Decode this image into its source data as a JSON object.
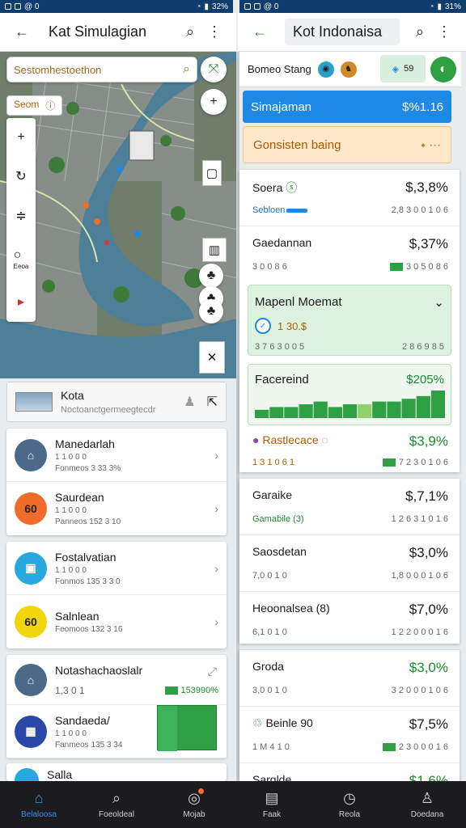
{
  "left": {
    "status": {
      "time": "@ 0",
      "battery": "32%"
    },
    "header": {
      "title": "Kat Simulagian"
    },
    "search": {
      "placeholder": "Sestomhestoethon"
    },
    "chip": {
      "label": "Seom"
    },
    "rail": {
      "small_label": "Eeoa"
    },
    "kota": {
      "title": "Kota",
      "subtitle": "Noctoanctgermeegtecdr"
    },
    "list": [
      {
        "title": "Manedarlah",
        "line1": "1 1 0 0 0",
        "line2": "Fonmeos 3 33 3%",
        "avatar_text": "",
        "avatar_color": "#4b6a89"
      },
      {
        "title": "Saurdean",
        "line1": "1 1 0 0 0",
        "line2": "Panneos 152 3 10",
        "avatar_text": "60",
        "avatar_color": "#ef6c2a"
      },
      {
        "title": "Fostalvatian",
        "line1": "1 1 0 0 0",
        "line2": "Fonmos 135 3 3 0",
        "avatar_text": "",
        "avatar_color": "#29a8e0"
      },
      {
        "title": "Salnlean",
        "line1": "",
        "line2": "Feomoos 132 3 16",
        "avatar_text": "60",
        "avatar_color": "#f0d60c"
      },
      {
        "title": "Notashachaoslalr",
        "line1": "1,3 0 1",
        "line2": "",
        "avatar_text": "",
        "avatar_color": "#4b6a89",
        "badge": "153990%"
      },
      {
        "title": "Sandaeda/",
        "line1": "1 1 0 0 0",
        "line2": "Fanmeos 135 3 34",
        "avatar_text": "",
        "avatar_color": "#2b48a8"
      },
      {
        "title": "Salla",
        "line1": "",
        "line2": "",
        "avatar_text": "",
        "avatar_color": "#29a8e0"
      }
    ]
  },
  "right": {
    "status": {
      "time": "@ 0",
      "battery": "31%"
    },
    "header": {
      "title": "Kot Indonaisa"
    },
    "bar": {
      "label": "Bomeo Stang",
      "pill": "59"
    },
    "banner_blue": {
      "label": "Simajaman",
      "value": "$%1.16"
    },
    "banner_orange": {
      "label": "Gonsisten baing"
    },
    "rows_a": [
      {
        "title": "Soera",
        "value": "$,3,8%",
        "sub": "Sebloen",
        "sub_right": "2,8 3 0 0 1 0 6"
      },
      {
        "title": "Gaedannan",
        "value": "$,37%",
        "sub": "3 0 0 8 6",
        "sub_right": "3 0 5 0 8 6"
      }
    ],
    "green_card": {
      "title": "Mapenl Moemat",
      "amount": "1 30.$",
      "sub_left": "3 7 6 3 0 0 5",
      "sub_right": "2 8 6 9 8 5"
    },
    "chart_card": {
      "title": "Facereind",
      "value": "$205%"
    },
    "rows_b": [
      {
        "title": "Rastlecace",
        "value": "$3,9%",
        "sub": "1 3 1 0 6 1",
        "sub_right": "7 2 3 0 1 0 6"
      }
    ],
    "rows_c": [
      {
        "title": "Garaike",
        "value": "$,7,1%",
        "sub": "Gamabile (3)",
        "sub_right": "1 2 6 3 1 0 1 6"
      },
      {
        "title": "Saosdetan",
        "value": "$3,0%",
        "sub": "7,0 0 1 0",
        "sub_right": "1,8 0 0 0 1 0 6"
      },
      {
        "title": "Heoonalsea (8)",
        "value": "$7,0%",
        "sub": "6,1 0 1 0",
        "sub_right": "1 2 2 0 0 0 1 6"
      }
    ],
    "rows_d": [
      {
        "title": "Groda",
        "value": "$3,0%",
        "sub": "3,0 0 1 0",
        "sub_right": "3 2 0 0 0 1 0 6"
      },
      {
        "title": "Beinle 90",
        "value": "$7,5%",
        "sub": "1 M 4 1 0",
        "sub_right": "2 3 0 0 0 1 6"
      },
      {
        "title": "Sarglde",
        "value": "$1,6%",
        "sub": "",
        "sub_right": ""
      }
    ]
  },
  "bottom_nav": [
    {
      "label": "Belaloosa",
      "icon": "home-icon"
    },
    {
      "label": "Foeoldeal",
      "icon": "search-icon"
    },
    {
      "label": "Mojab",
      "icon": "compass-icon"
    },
    {
      "label": "Faak",
      "icon": "book-icon"
    },
    {
      "label": "Reola",
      "icon": "clock-icon"
    },
    {
      "label": "Doedana",
      "icon": "profile-icon"
    }
  ],
  "chart_data": {
    "type": "bar",
    "values": [
      6,
      8,
      8,
      10,
      12,
      8,
      10,
      10,
      12,
      12,
      14,
      16,
      20
    ]
  }
}
